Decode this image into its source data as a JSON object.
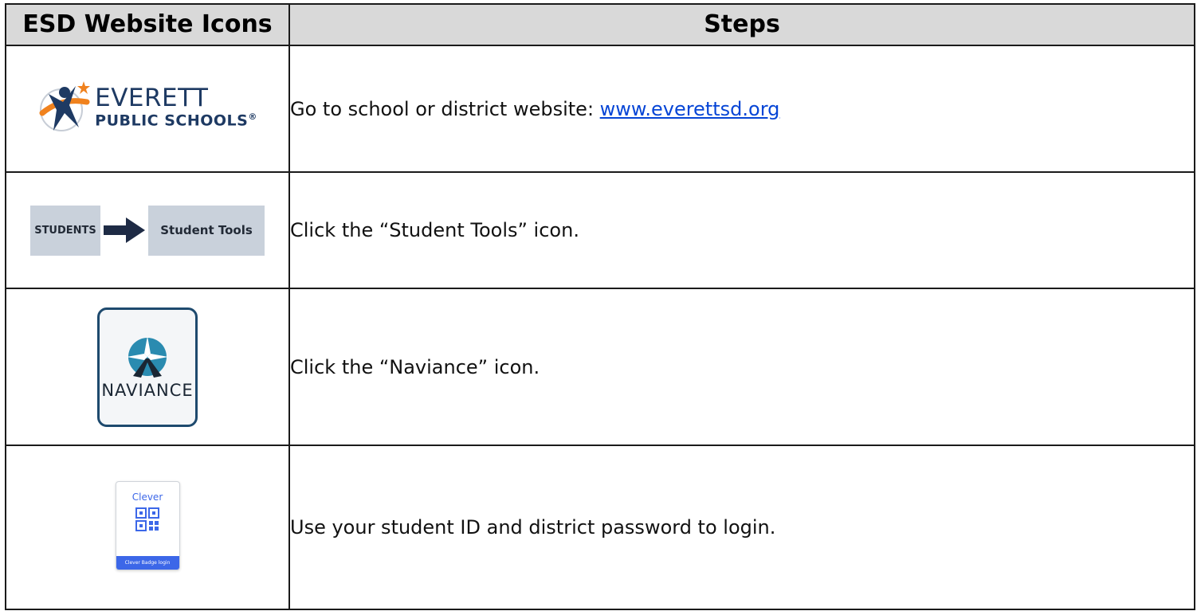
{
  "table": {
    "headers": [
      "ESD Website Icons",
      "Steps"
    ],
    "rows": [
      {
        "icon": {
          "name": "everett-public-schools-logo",
          "line1": "EVERETT",
          "line2": "PUBLIC SCHOOLS",
          "mark": "®"
        },
        "step_text": "Go to school or district website: ",
        "step_link": "www.everettsd.org"
      },
      {
        "icon": {
          "name": "students-to-student-tools",
          "students_label": "STUDENTS",
          "tools_label": "Student Tools"
        },
        "step_text": "Click the “Student Tools” icon."
      },
      {
        "icon": {
          "name": "naviance-icon",
          "label": "NAVIANCE"
        },
        "step_text": "Click the “Naviance” icon."
      },
      {
        "icon": {
          "name": "clever-badge-icon",
          "brand": "Clever",
          "footer": "Clever Badge login"
        },
        "step_text": "Use your student ID and district password to login."
      }
    ]
  },
  "colors": {
    "header_bg": "#d9d9d9",
    "link": "#0645d6",
    "everett_navy": "#1e3a63",
    "everett_orange": "#f0821e",
    "tools_box": "#c9d1db",
    "naviance_border": "#1e4a6e",
    "naviance_teal": "#2a8bb0",
    "clever_blue": "#3c67e8"
  }
}
